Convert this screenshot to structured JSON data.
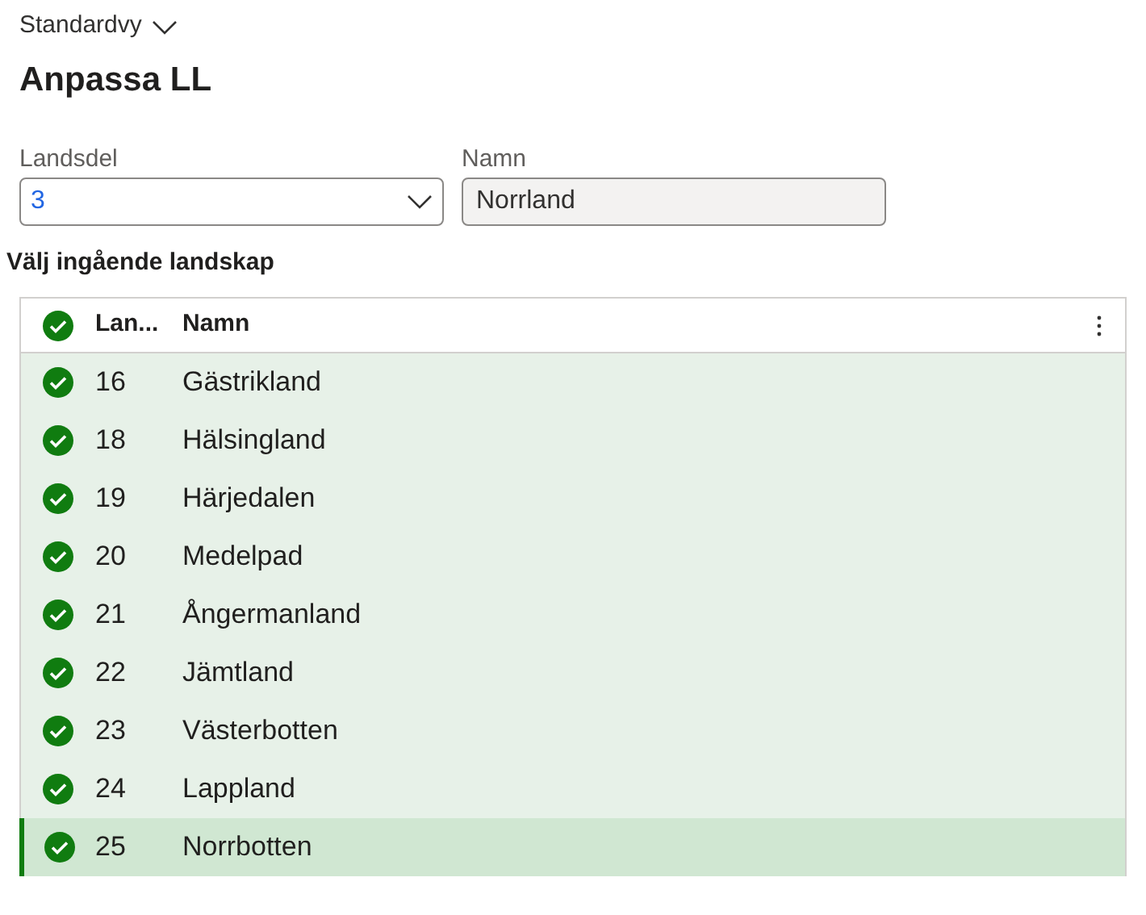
{
  "view_selector": {
    "label": "Standardvy"
  },
  "title": "Anpassa LL",
  "fields": [
    {
      "label": "Landsdel",
      "value": "3",
      "kind": "dropdown"
    },
    {
      "label": "Namn",
      "value": "Norrland",
      "kind": "readonly"
    }
  ],
  "section_title": "Välj ingående landskap",
  "grid": {
    "all_checked": true,
    "columns": [
      "Lan...",
      "Namn"
    ],
    "rows": [
      {
        "cells": [
          "16",
          "Gästrikland"
        ],
        "checked": true,
        "selected": false
      },
      {
        "cells": [
          "18",
          "Hälsingland"
        ],
        "checked": true,
        "selected": false
      },
      {
        "cells": [
          "19",
          "Härjedalen"
        ],
        "checked": true,
        "selected": false
      },
      {
        "cells": [
          "20",
          "Medelpad"
        ],
        "checked": true,
        "selected": false
      },
      {
        "cells": [
          "21",
          "Ångermanland"
        ],
        "checked": true,
        "selected": false
      },
      {
        "cells": [
          "22",
          "Jämtland"
        ],
        "checked": true,
        "selected": false
      },
      {
        "cells": [
          "23",
          "Västerbotten"
        ],
        "checked": true,
        "selected": false
      },
      {
        "cells": [
          "24",
          "Lappland"
        ],
        "checked": true,
        "selected": false
      },
      {
        "cells": [
          "25",
          "Norrbotten"
        ],
        "checked": true,
        "selected": true
      }
    ]
  }
}
